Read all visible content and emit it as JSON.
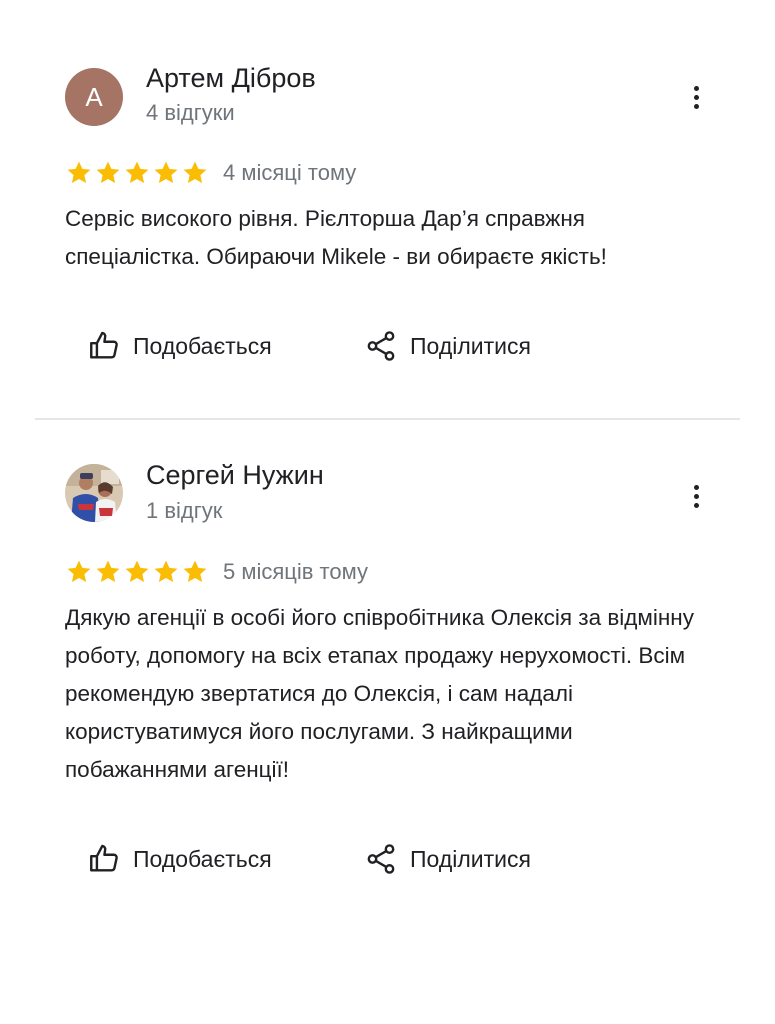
{
  "colors": {
    "star": "#fbbc04",
    "avatar_letter_bg": "#a57464",
    "secondary_text": "#70757a",
    "divider": "#e6e6e6"
  },
  "actions": {
    "like_label": "Подобається",
    "share_label": "Поділитися",
    "like_icon": "thumb-up-outline-icon",
    "share_icon": "share-icon",
    "more_icon": "more-vertical-icon"
  },
  "reviews": [
    {
      "author": "Артем Дібров",
      "avatar_letter": "А",
      "review_count": "4 відгуки",
      "rating": 5,
      "date": "4 місяці тому",
      "text": "Сервіс високого рівня. Рієлторша Дар’я справжня спеціалістка. Обираючи Mikele - ви обираєте якість!"
    },
    {
      "author": "Сергей Нужин",
      "avatar_letter": "",
      "review_count": "1 відгук",
      "rating": 5,
      "date": "5 місяців тому",
      "text": "Дякую агенції в особі його співробітника Олексія за відмінну роботу, допомогу на всіх етапах продажу нерухомості.  Всім рекомендую звертатися до Олексія, і сам надалі користуватимуся його послугами.  З найкращими побажаннями агенції!"
    }
  ]
}
